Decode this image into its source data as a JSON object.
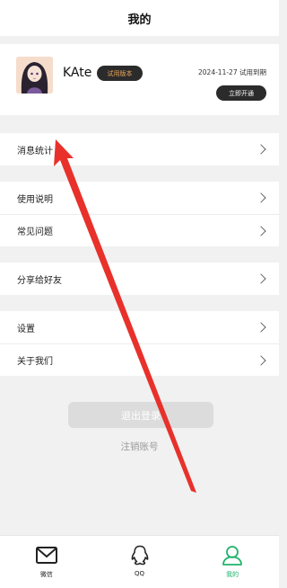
{
  "header": {
    "title": "我的"
  },
  "profile": {
    "username": "KAte",
    "trial_badge": "试用版本",
    "expire_text": "2024-11-27 试用到期",
    "activate_label": "立即开通"
  },
  "menu": {
    "stats": "消息统计",
    "usage": "使用说明",
    "faq": "常见问题",
    "share": "分享给好友",
    "settings": "设置",
    "about": "关于我们"
  },
  "actions": {
    "logout_label": "退出登录",
    "cancel_account_label": "注销账号"
  },
  "tabbar": {
    "tabs": [
      {
        "label": "微信",
        "icon": "mail-icon",
        "active": false
      },
      {
        "label": "QQ",
        "icon": "qq-icon",
        "active": false
      },
      {
        "label": "我的",
        "icon": "user-icon",
        "active": true
      }
    ]
  },
  "colors": {
    "active_tab": "#21b36b",
    "annotation_arrow": "#e8312b",
    "badge_bg": "#2b2b2b",
    "badge_text": "#e9a45a"
  }
}
